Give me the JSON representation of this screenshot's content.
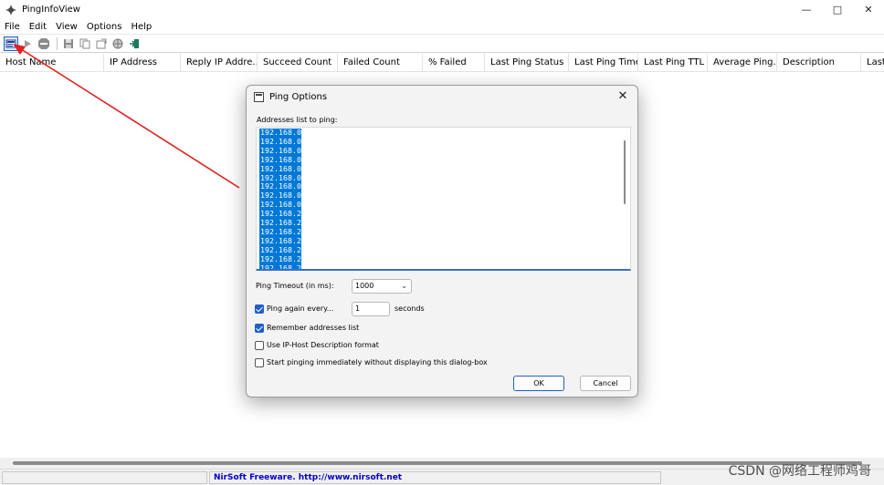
{
  "window": {
    "title": "PingInfoView"
  },
  "menu": [
    "File",
    "Edit",
    "View",
    "Options",
    "Help"
  ],
  "toolbar": {
    "icons": [
      "ping-options-icon",
      "start-icon",
      "stop-icon",
      "save-icon",
      "copy-icon",
      "properties-icon",
      "html-report-icon",
      "exit-icon"
    ]
  },
  "columns": [
    "Host Name",
    "IP Address",
    "Reply IP Addre...",
    "Succeed Count",
    "Failed Count",
    "% Failed",
    "Last Ping Status",
    "Last Ping Time",
    "Last Ping TTL",
    "Average Ping...",
    "Description",
    "Last"
  ],
  "status": {
    "link": "NirSoft Freeware.  http://www.nirsoft.net"
  },
  "watermark": "CSDN @网络工程师鸡哥",
  "dialog": {
    "title": "Ping Options",
    "addresses_label": "Addresses list to ping:",
    "addresses": [
      "192.168.0.1",
      "192.168.0.2",
      "192.168.0.3",
      "192.168.0.4",
      "192.168.0.5",
      "192.168.0.6",
      "192.168.0.7",
      "192.168.0.8",
      "192.168.0.9",
      "192.168.2.1",
      "192.168.2.2",
      "192.168.2.3",
      "192.168.2.4",
      "192.168.2.5",
      "192.168.2.6",
      "192.168.2.7"
    ],
    "timeout_label": "Ping Timeout (in ms):",
    "timeout_value": "1000",
    "ping_again_label": "Ping again every...",
    "ping_again_checked": true,
    "ping_again_value": "1",
    "seconds_label": "seconds",
    "remember_label": "Remember addresses list",
    "remember_checked": true,
    "ip_host_label": "Use IP-Host Description format",
    "ip_host_checked": false,
    "start_label": "Start pinging immediately without displaying this dialog-box",
    "start_checked": false,
    "ok_label": "OK",
    "cancel_label": "Cancel"
  },
  "colors": {
    "accent": "#1f5fc8",
    "selection": "#0078d7",
    "annotation_arrow": "#e02020"
  }
}
